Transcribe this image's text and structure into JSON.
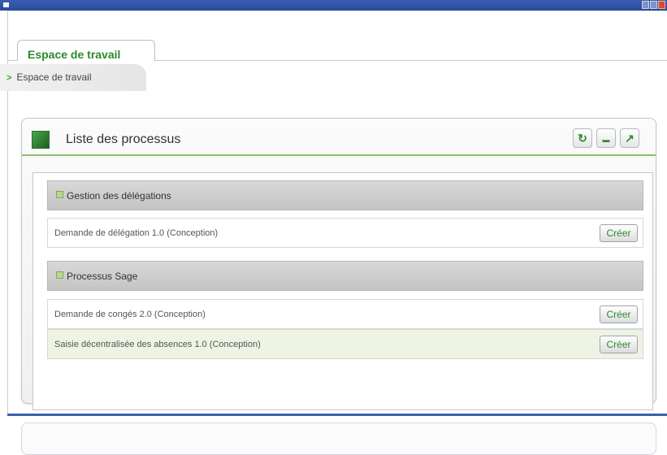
{
  "tab": {
    "label": "Espace de travail"
  },
  "breadcrumb": {
    "label": "Espace de travail",
    "arrow": ">"
  },
  "panel": {
    "title": "Liste des processus",
    "buttons": [
      {
        "icon": "refresh-icon",
        "glyph": "↻"
      },
      {
        "icon": "minimize-icon",
        "glyph": "▬"
      },
      {
        "icon": "maximize-icon",
        "glyph": "↗"
      }
    ],
    "groups": [
      {
        "name": "Gestion des délégations",
        "items": [
          {
            "label": "Demande de délégation 1.0 (Conception)",
            "button": "Créer"
          }
        ]
      },
      {
        "name": "Processus Sage",
        "items": [
          {
            "label": "Demande de congés 2.0 (Conception)",
            "button": "Créer"
          },
          {
            "label": "Saisie décentralisée des absences 1.0 (Conception)",
            "button": "Créer"
          }
        ]
      }
    ]
  },
  "colors": {
    "accent": "#2b8a2b",
    "titlebar": "#3a5fb0",
    "row_alt": "#eef4e4"
  }
}
